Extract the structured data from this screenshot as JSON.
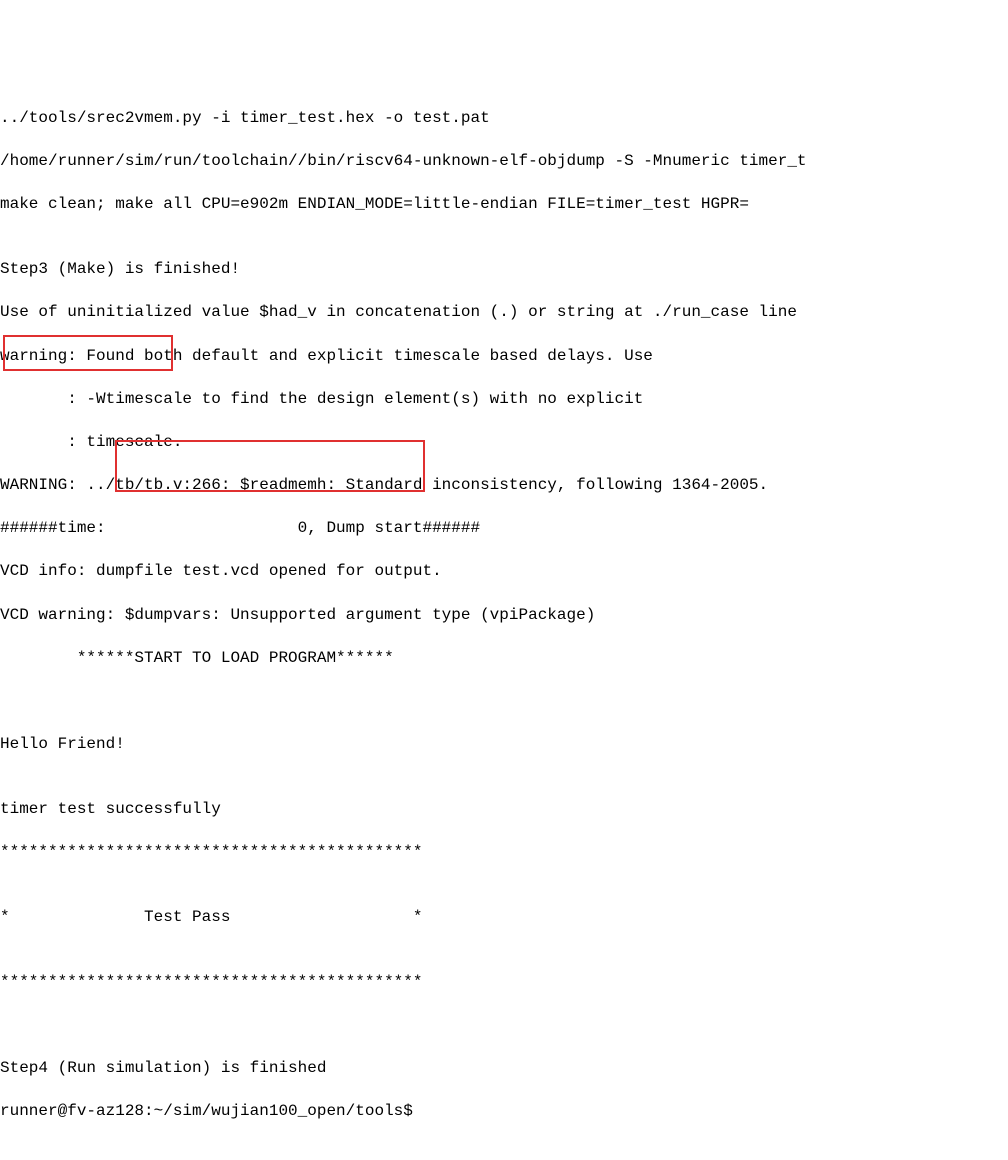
{
  "lines": {
    "l0": "../tools/srec2vmem.py -i timer_test.hex -o test.pat",
    "l1": "/home/runner/sim/run/toolchain//bin/riscv64-unknown-elf-objdump -S -Mnumeric timer_t",
    "l2": "make clean; make all CPU=e902m ENDIAN_MODE=little-endian FILE=timer_test HGPR=",
    "l3": "",
    "l4": "Step3 (Make) is finished!",
    "l5": "Use of uninitialized value $had_v in concatenation (.) or string at ./run_case line",
    "l6": "warning: Found both default and explicit timescale based delays. Use",
    "l7": "       : -Wtimescale to find the design element(s) with no explicit",
    "l8": "       : timescale.",
    "l9": "WARNING: ../tb/tb.v:266: $readmemh: Standard inconsistency, following 1364-2005.",
    "l10": "######time:                    0, Dump start######",
    "l11": "VCD info: dumpfile test.vcd opened for output.",
    "l12": "VCD warning: $dumpvars: Unsupported argument type (vpiPackage)",
    "l13": "        ******START TO LOAD PROGRAM******",
    "l14": "",
    "l15": "",
    "l16": "Hello Friend!",
    "l17": "",
    "l18": "timer test successfully",
    "l19": "********************************************",
    "l20": "",
    "l21": "*              Test Pass                   *",
    "l22": "",
    "l23": "********************************************",
    "l24": "",
    "l25": "",
    "l26": "Step4 (Run simulation) is finished",
    "l27": "runner@fv-az128:~/sim/wujian100_open/tools$"
  }
}
